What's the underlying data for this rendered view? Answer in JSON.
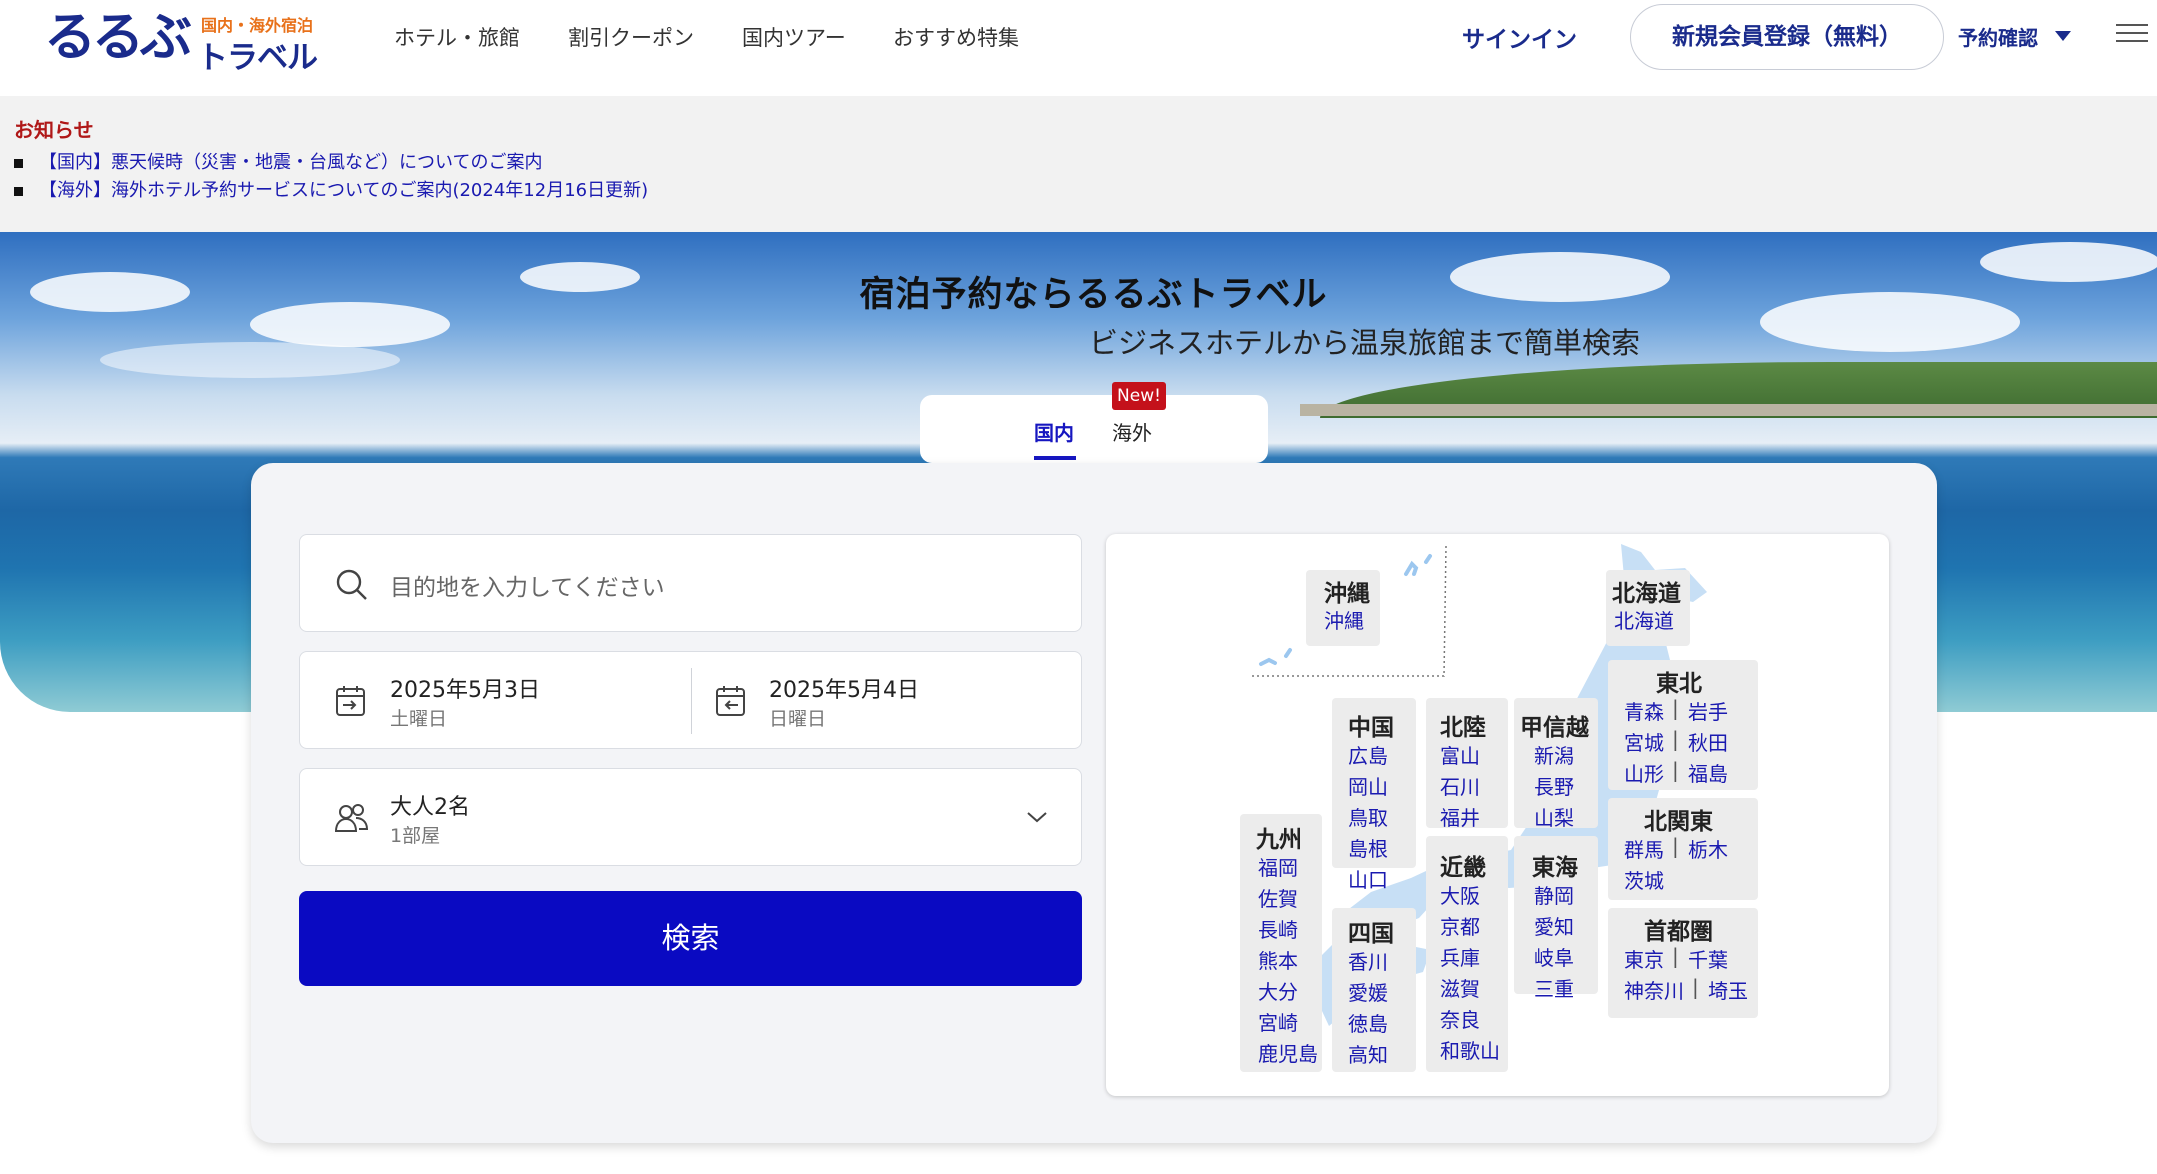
{
  "header": {
    "logo_main": "るるぶ",
    "logo_sub": "国内・海外宿泊",
    "logo_travel": "トラベル",
    "nav": [
      "ホテル・旅館",
      "割引クーポン",
      "国内ツアー",
      "おすすめ特集"
    ],
    "signin": "サインイン",
    "register": "新規会員登録（無料）",
    "reservation": "予約確認"
  },
  "notice": {
    "title": "お知らせ",
    "items": [
      "【国内】悪天候時（災害・地震・台風など）についてのご案内",
      "【海外】海外ホテル予約サービスについてのご案内(2024年12月16日更新)"
    ]
  },
  "hero": {
    "title": "宿泊予約ならるるぶトラベル",
    "subtitle": "ビジネスホテルから温泉旅館まで簡単検索"
  },
  "tabs": {
    "domestic": "国内",
    "overseas": "海外",
    "new_badge": "New!"
  },
  "search": {
    "destination_placeholder": "目的地を入力してください",
    "checkin_date": "2025年5月3日",
    "checkin_day": "土曜日",
    "checkout_date": "2025年5月4日",
    "checkout_day": "日曜日",
    "guests": "大人2名",
    "rooms": "1部屋",
    "button": "検索"
  },
  "map": {
    "okinawa": {
      "name": "沖縄",
      "prefs": [
        "沖縄"
      ]
    },
    "hokkaido": {
      "name": "北海道",
      "prefs": [
        "北海道"
      ]
    },
    "tohoku": {
      "name": "東北",
      "prefs": [
        "青森",
        "岩手",
        "宮城",
        "秋田",
        "山形",
        "福島"
      ]
    },
    "kitakanto": {
      "name": "北関東",
      "prefs": [
        "群馬",
        "栃木",
        "茨城"
      ]
    },
    "shutoken": {
      "name": "首都圏",
      "prefs": [
        "東京",
        "千葉",
        "神奈川",
        "埼玉"
      ]
    },
    "koshinetsu": {
      "name": "甲信越",
      "prefs": [
        "新潟",
        "長野",
        "山梨"
      ]
    },
    "tokai": {
      "name": "東海",
      "prefs": [
        "静岡",
        "愛知",
        "岐阜",
        "三重"
      ]
    },
    "hokuriku": {
      "name": "北陸",
      "prefs": [
        "富山",
        "石川",
        "福井"
      ]
    },
    "kinki": {
      "name": "近畿",
      "prefs": [
        "大阪",
        "京都",
        "兵庫",
        "滋賀",
        "奈良",
        "和歌山"
      ]
    },
    "chugoku": {
      "name": "中国",
      "prefs": [
        "広島",
        "岡山",
        "鳥取",
        "島根",
        "山口"
      ]
    },
    "shikoku": {
      "name": "四国",
      "prefs": [
        "香川",
        "愛媛",
        "徳島",
        "高知"
      ]
    },
    "kyushu": {
      "name": "九州",
      "prefs": [
        "福岡",
        "佐賀",
        "長崎",
        "熊本",
        "大分",
        "宮崎",
        "鹿児島"
      ]
    }
  }
}
